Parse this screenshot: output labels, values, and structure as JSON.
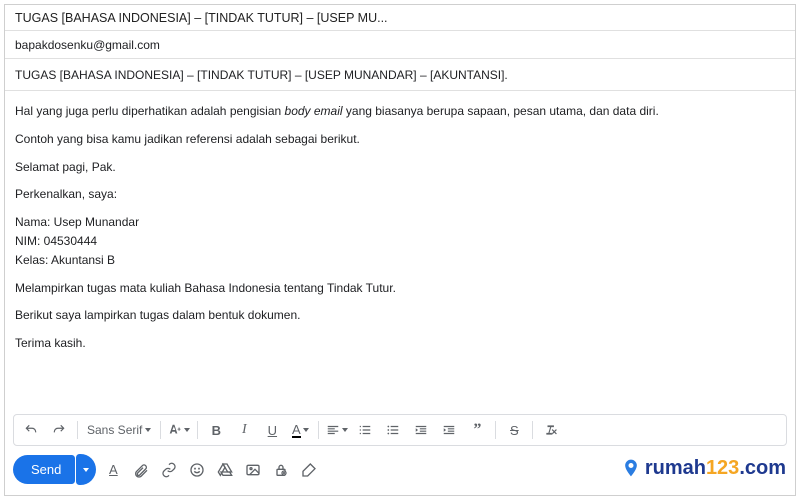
{
  "header": {
    "title": "TUGAS [BAHASA INDONESIA] – [TINDAK TUTUR] – [USEP MU..."
  },
  "compose": {
    "to": "bapakdosenku@gmail.com",
    "subject": "TUGAS [BAHASA INDONESIA] – [TINDAK TUTUR] – [USEP MUNANDAR]  – [AKUNTANSI]."
  },
  "body": {
    "p1_pre": "Hal yang juga perlu diperhatikan adalah pengisian ",
    "p1_italic": "body email",
    "p1_post": " yang biasanya berupa sapaan, pesan utama, dan data diri.",
    "p2": "Contoh yang bisa kamu jadikan referensi adalah sebagai berikut.",
    "p3": "Selamat pagi, Pak.",
    "p4": "Perkenalkan, saya:",
    "name": "Nama: Usep Munandar",
    "nim": "NIM: 04530444",
    "kelas": "Kelas: Akuntansi B",
    "p5": "Melampirkan tugas mata kuliah Bahasa Indonesia tentang Tindak Tutur.",
    "p6": "Berikut saya lampirkan tugas dalam bentuk dokumen.",
    "p7": "Terima kasih."
  },
  "toolbar": {
    "font": "Sans Serif",
    "send_label": "Send"
  },
  "watermark": {
    "brand_part1": "rumah",
    "brand_part2": "123",
    "brand_part3": ".com"
  }
}
